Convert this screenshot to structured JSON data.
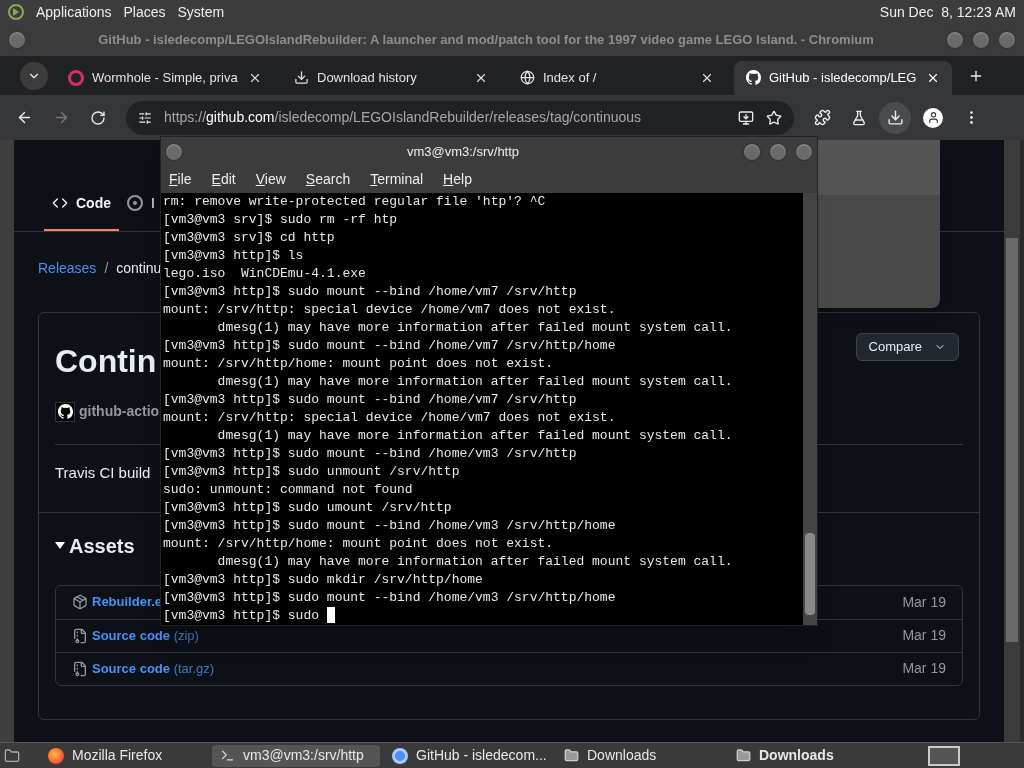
{
  "top_panel": {
    "menus": [
      "Applications",
      "Places",
      "System"
    ],
    "clock": "Sun Dec  8, 12:23 AM"
  },
  "browser": {
    "title": "GitHub - isledecomp/LEGOIslandRebuilder: A launcher and mod/patch tool for the 1997 video game LEGO Island. - Chromium",
    "tabs": [
      {
        "kind": "ring",
        "label": "Wormhole - Simple, priva",
        "selected": false
      },
      {
        "kind": "download",
        "label": "Download history",
        "selected": false
      },
      {
        "kind": "globe",
        "label": "Index of /",
        "selected": false
      },
      {
        "kind": "github",
        "label": "GitHub - isledecomp/LEG",
        "selected": true
      }
    ],
    "url": {
      "scheme": "https://",
      "host": "github.com",
      "path": "/isledecomp/LEGOIslandRebuilder/releases/tag/continuous"
    }
  },
  "page": {
    "repo_tabs": [
      {
        "kind": "code",
        "label": "Code",
        "selected": true
      },
      {
        "kind": "issues",
        "label": "I",
        "selected": false
      }
    ],
    "breadcrumb": {
      "link": "Releases",
      "separator": "/",
      "current": "continu"
    },
    "release": {
      "title": "Contin",
      "author": "github-actio",
      "compare": "Compare",
      "body": "Travis CI build",
      "assets_title": "Assets",
      "assets": [
        {
          "kind": "package",
          "name": "Rebuilder.e",
          "date": "Mar 19"
        },
        {
          "kind": "source",
          "name": "Source code",
          "suffix": "(zip)",
          "date": "Mar 19"
        },
        {
          "kind": "source",
          "name": "Source code",
          "suffix": "(tar.gz)",
          "date": "Mar 19"
        }
      ]
    }
  },
  "terminal": {
    "title": "vm3@vm3:/srv/http",
    "menu": [
      "File",
      "Edit",
      "View",
      "Search",
      "Terminal",
      "Help"
    ],
    "lines": [
      "rm: remove write-protected regular file 'htp'? ^C",
      "[vm3@vm3 srv]$ sudo rm -rf htp",
      "[vm3@vm3 srv]$ cd http",
      "[vm3@vm3 http]$ ls",
      "lego.iso  WinCDEmu-4.1.exe",
      "[vm3@vm3 http]$ sudo mount --bind /home/vm7 /srv/http",
      "mount: /srv/http: special device /home/vm7 does not exist.",
      "       dmesg(1) may have more information after failed mount system call.",
      "[vm3@vm3 http]$ sudo mount --bind /home/vm7 /srv/http/home",
      "mount: /srv/http/home: mount point does not exist.",
      "       dmesg(1) may have more information after failed mount system call.",
      "[vm3@vm3 http]$ sudo mount --bind /home/vm7 /srv/http",
      "mount: /srv/http: special device /home/vm7 does not exist.",
      "       dmesg(1) may have more information after failed mount system call.",
      "[vm3@vm3 http]$ sudo mount --bind /home/vm3 /srv/http",
      "[vm3@vm3 http]$ sudo unmount /srv/http",
      "sudo: unmount: command not found",
      "[vm3@vm3 http]$ sudo umount /srv/http",
      "[vm3@vm3 http]$ sudo mount --bind /home/vm3 /srv/http/home",
      "mount: /srv/http/home: mount point does not exist.",
      "       dmesg(1) may have more information after failed mount system call.",
      "[vm3@vm3 http]$ sudo mkdir /srv/http/home",
      "[vm3@vm3 http]$ sudo mount --bind /home/vm3 /srv/http/home",
      "[vm3@vm3 http]$ sudo "
    ]
  },
  "taskbar": [
    {
      "kind": "firefox",
      "label": "Mozilla Firefox",
      "selected": false,
      "bold": false
    },
    {
      "kind": "terminal",
      "label": "vm3@vm3:/srv/http",
      "selected": true,
      "bold": false
    },
    {
      "kind": "chromium",
      "label": "GitHub - isledecom...",
      "selected": false,
      "bold": false
    },
    {
      "kind": "folder",
      "label": "Downloads",
      "selected": false,
      "bold": false
    },
    {
      "kind": "folder",
      "label": "Downloads",
      "selected": false,
      "bold": true
    }
  ]
}
